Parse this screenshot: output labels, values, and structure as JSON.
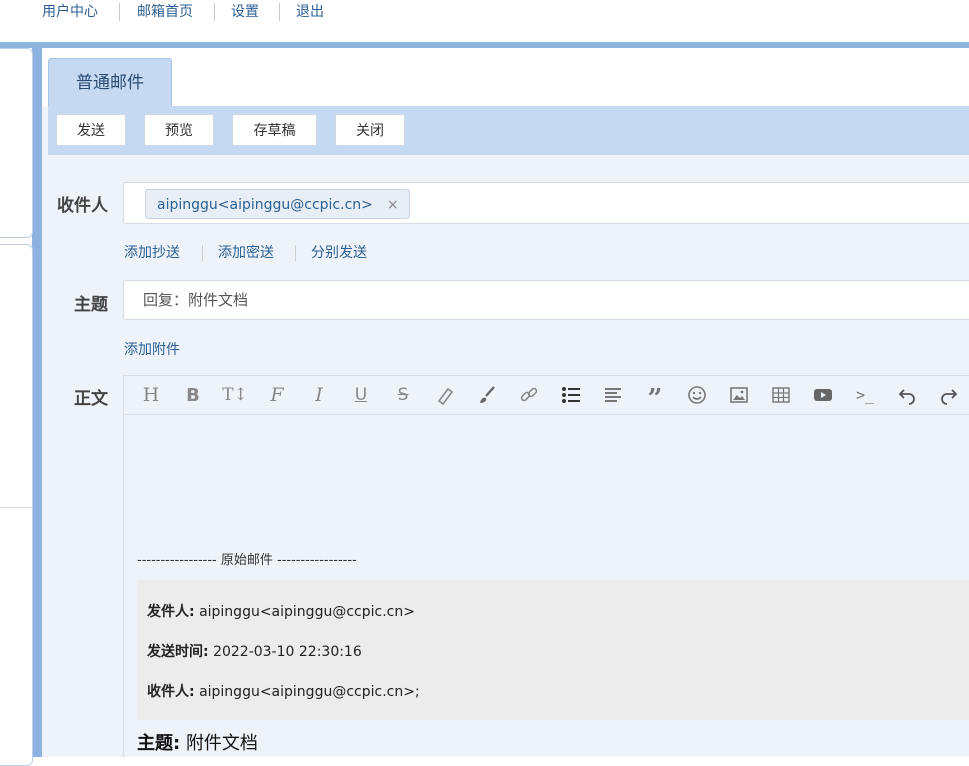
{
  "topnav": {
    "links": [
      "用户中心",
      "邮箱首页",
      "设置",
      "退出"
    ]
  },
  "tab": {
    "label": "普通邮件"
  },
  "toolbar": {
    "send": "发送",
    "preview": "预览",
    "save_draft": "存草稿",
    "close": "关闭"
  },
  "recipient": {
    "label": "收件人",
    "chip": "aipinggu<aipinggu@ccpic.cn>",
    "chip_remove": "×"
  },
  "recipient_links": {
    "add_cc": "添加抄送",
    "add_bcc": "添加密送",
    "send_separately": "分别发送"
  },
  "subject": {
    "label": "主题",
    "value": "回复：附件文档"
  },
  "attachment": {
    "add_label": "添加附件"
  },
  "body": {
    "label": "正文",
    "original_divider": "----------------- 原始邮件 -----------------",
    "from_label": "发件人:",
    "from_value": "aipinggu<aipinggu@ccpic.cn>",
    "sent_time_label": "发送时间:",
    "sent_time_value": "2022-03-10 22:30:16",
    "to_label": "收件人:",
    "to_value": "aipinggu<aipinggu@ccpic.cn>;",
    "subject_label": "主题:",
    "subject_value": "附件文档"
  },
  "editor_toolbar": {
    "icons": [
      "heading-icon",
      "bold-icon",
      "font-size-icon",
      "font-family-icon",
      "italic-icon",
      "underline-icon",
      "strikethrough-icon",
      "highlighter-icon",
      "brush-icon",
      "link-icon",
      "bulleted-list-icon",
      "align-left-icon",
      "quote-icon",
      "emoji-icon",
      "image-icon",
      "table-icon",
      "video-icon",
      "code-icon",
      "undo-icon",
      "redo-icon"
    ]
  },
  "colors": {
    "frame": "#8db2e0",
    "toolbar_bg": "#c5daf2",
    "panel_bg": "#eef3fa",
    "link": "#2c5f94"
  }
}
